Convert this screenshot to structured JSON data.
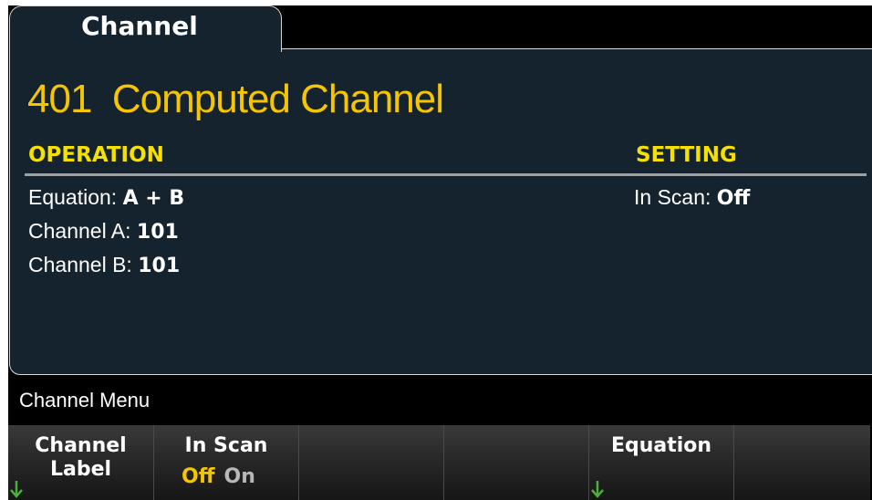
{
  "tab": {
    "label": "Channel"
  },
  "channel": {
    "number": "401",
    "name": "Computed Channel"
  },
  "operation": {
    "heading": "OPERATION",
    "equation": {
      "label": "Equation:",
      "value": "A + B"
    },
    "channel_a": {
      "label": "Channel A:",
      "value": "101"
    },
    "channel_b": {
      "label": "Channel B:",
      "value": "101"
    }
  },
  "setting": {
    "heading": "SETTING",
    "in_scan": {
      "label": "In Scan:",
      "value": "Off"
    }
  },
  "menu": {
    "title": "Channel Menu"
  },
  "softkeys": {
    "channel_label": {
      "line1": "Channel",
      "line2": "Label",
      "submenu_icon": "down-arrow-icon"
    },
    "in_scan": {
      "label": "In Scan",
      "selected": "Off",
      "other": "On"
    },
    "equation": {
      "label": "Equation",
      "submenu_icon": "down-arrow-icon"
    }
  },
  "colors": {
    "panel_bg": "#14232d",
    "accent_yellow": "#f5c500",
    "heading_yellow": "#f5e000",
    "arrow_green": "#4caf3a"
  }
}
